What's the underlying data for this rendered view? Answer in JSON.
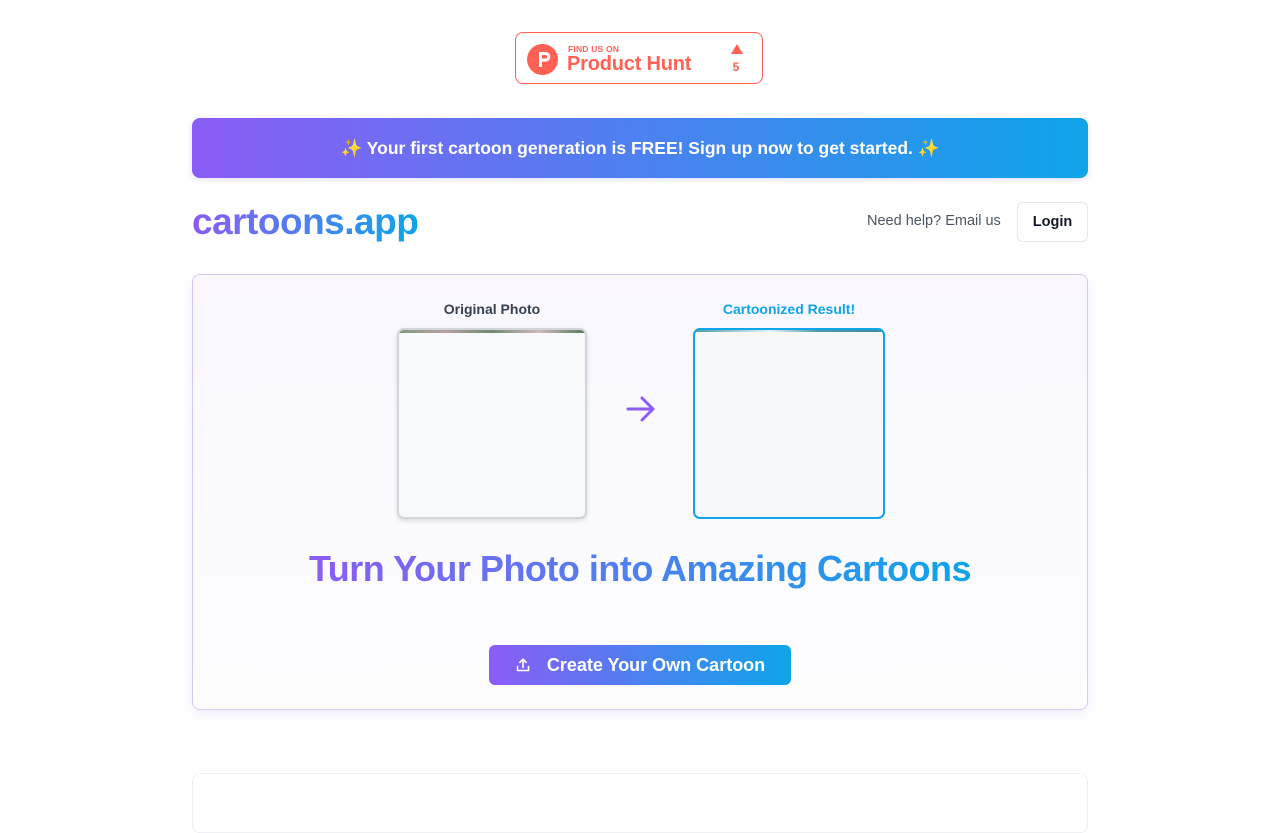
{
  "product_hunt": {
    "find_us_on": "FIND US ON",
    "name": "Product Hunt",
    "upvote_count": "5",
    "logo_letter": "P",
    "color": "#ff6154"
  },
  "promo_banner": {
    "text": "✨ Your first cartoon generation is FREE! Sign up now to get started. ✨"
  },
  "header": {
    "logo": "cartoons.app",
    "help_text": "Need help? Email us",
    "login_label": "Login"
  },
  "hero": {
    "original_label": "Original Photo",
    "result_label": "Cartoonized Result!",
    "arrow_icon": "arrow-right-icon",
    "headline": "Turn Your Photo into Amazing Cartoons",
    "cta_label": "Create Your Own Cartoon",
    "cta_icon": "upload-icon"
  },
  "colors": {
    "gradient_start": "#8b5cf6",
    "gradient_end": "#0ea5e9",
    "result_border": "#0ea5e9"
  }
}
